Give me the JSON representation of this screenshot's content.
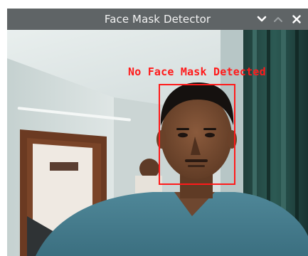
{
  "window": {
    "title": "Face Mask Detector",
    "controls": {
      "minimize_icon": "chevron-down-icon",
      "maximize_icon": "chevron-up-icon",
      "close_icon": "close-icon"
    }
  },
  "detection": {
    "label": "No Face Mask Detected",
    "box_color": "#ff1a1a"
  },
  "colors": {
    "titlebar": "#5f6466",
    "title_text": "#f2f2f2"
  }
}
